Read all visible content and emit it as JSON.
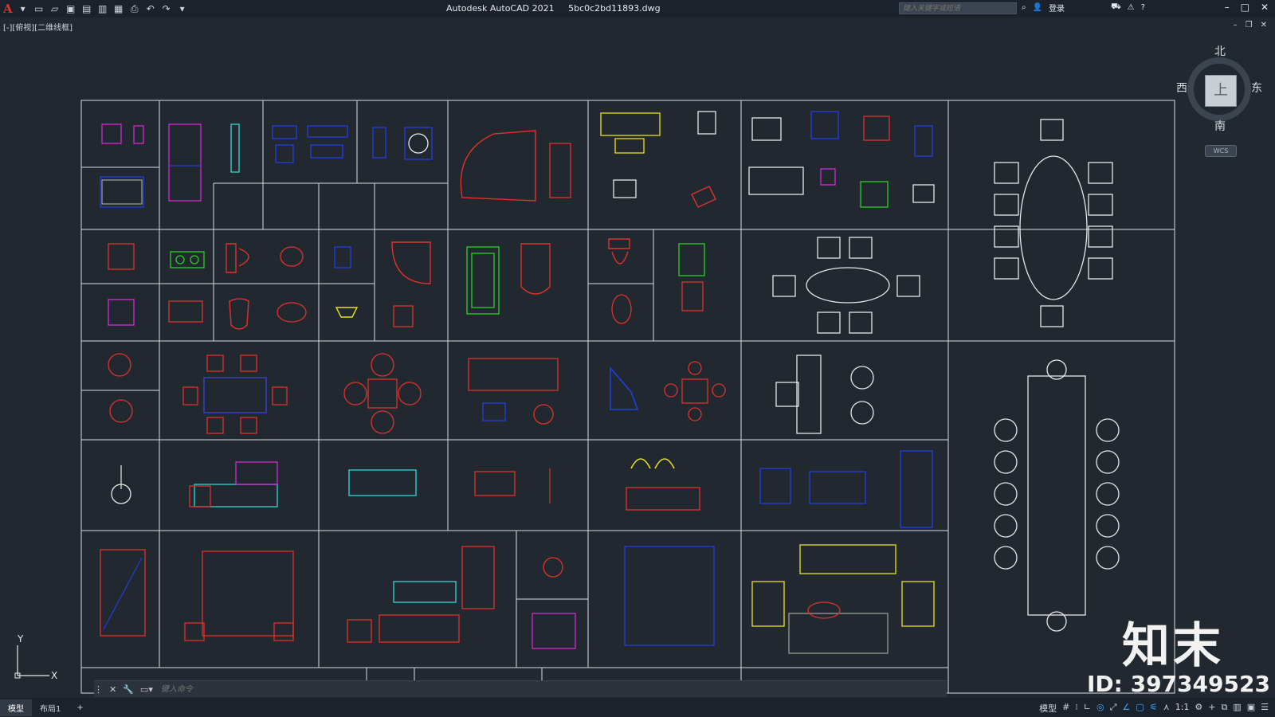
{
  "app": {
    "title": "Autodesk AutoCAD 2021",
    "file": "5bc0c2bd11893.dwg",
    "logo": "A"
  },
  "search": {
    "placeholder": "键入关键字或短语"
  },
  "account": {
    "login_label": "登录"
  },
  "viewport": {
    "label": "[-][俯视][二维线框]"
  },
  "viewcube": {
    "north": "北",
    "south": "南",
    "east": "东",
    "west": "西",
    "face": "上",
    "wcs": "WCS"
  },
  "ucs": {
    "x": "X",
    "y": "Y"
  },
  "command": {
    "placeholder": "键入命令"
  },
  "tabs": [
    {
      "label": "模型",
      "active": true
    },
    {
      "label": "布局1",
      "active": false
    },
    {
      "label": "+",
      "active": false
    }
  ],
  "status": {
    "model_label": "模型",
    "scale": "1:1"
  },
  "watermark": {
    "brand": "知末",
    "id": "ID: 397349523"
  },
  "colors": {
    "bg": "#212830",
    "grid": "#d8dbe0",
    "red": "#e0322d",
    "blue": "#1f3fe0",
    "cyan": "#2fd6d6",
    "yellow": "#e8e020",
    "green": "#28d028",
    "magenta": "#d22ad8",
    "white": "#e8e8e8",
    "gray": "#9a9a9a"
  }
}
